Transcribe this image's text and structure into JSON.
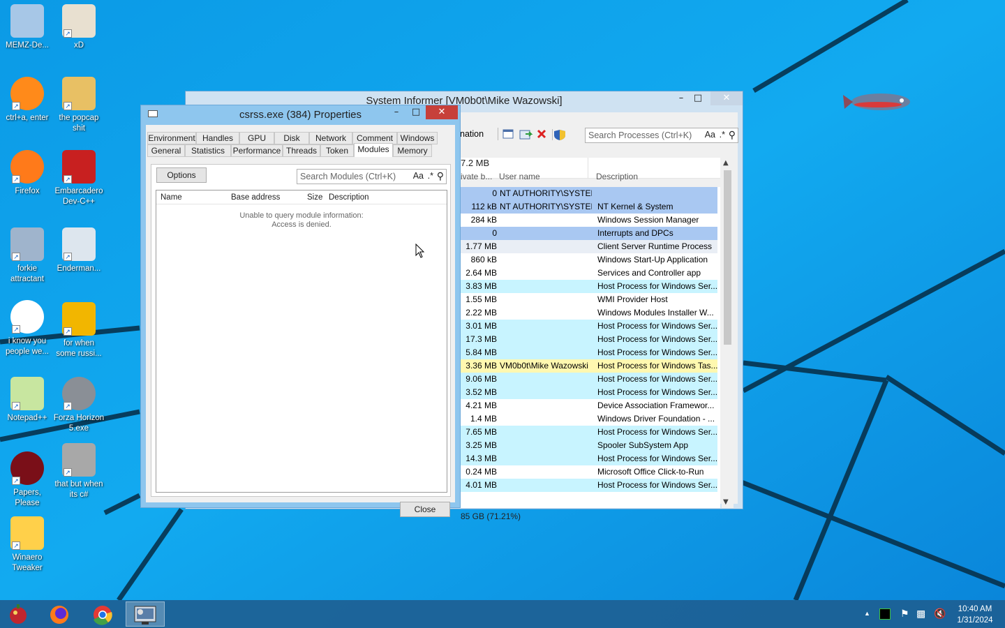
{
  "desktop_icons": [
    {
      "label": "MEMZ-De...",
      "icon": "recycle-bin-icon"
    },
    {
      "label": "xD",
      "icon": "xd-image-icon"
    },
    {
      "label": "ctrl+a, enter",
      "icon": "search-ring-icon"
    },
    {
      "label": "the popcap shit",
      "icon": "popcap-folder-icon"
    },
    {
      "label": "Firefox",
      "icon": "firefox-icon"
    },
    {
      "label": "Embarcadero Dev-C++",
      "icon": "devcpp-icon"
    },
    {
      "label": "forkie attractant",
      "icon": "system-informer-icon"
    },
    {
      "label": "Enderman...",
      "icon": "enderman-image-icon"
    },
    {
      "label": "i know you people we...",
      "icon": "chrome-icon"
    },
    {
      "label": "for when some russi...",
      "icon": "de-document-icon"
    },
    {
      "label": "Notepad++",
      "icon": "notepadpp-icon"
    },
    {
      "label": "Forza Horizon 5.exe",
      "icon": "flash-icon"
    },
    {
      "label": "Papers, Please",
      "icon": "papers-please-icon"
    },
    {
      "label": "that but when its c#",
      "icon": "copy-stack-icon"
    },
    {
      "label": "Winaero Tweaker",
      "icon": "winaero-icon"
    }
  ],
  "system_informer": {
    "title": "System Informer [VM0b0t\\Mike Wazowski]",
    "toolbar_partial_label": "nation",
    "search_placeholder": "Search Processes (Ctrl+K)",
    "search_case": "Aa",
    "search_regex": ".*",
    "header_total": "7.2 MB",
    "columns": {
      "private_bytes": "ivate b...",
      "user_name": "User name",
      "description": "Description"
    },
    "rows": [
      {
        "mem": "0",
        "user": "NT AUTHORITY\\SYSTEM",
        "desc": "",
        "hl": "#a9c8f2"
      },
      {
        "mem": "112 kB",
        "user": "NT AUTHORITY\\SYSTEM",
        "desc": "NT Kernel & System",
        "hl": "#a9c8f2"
      },
      {
        "mem": "284 kB",
        "user": "",
        "desc": "Windows Session Manager",
        "hl": ""
      },
      {
        "mem": "0",
        "user": "",
        "desc": "Interrupts and DPCs",
        "hl": "#a9c8f2"
      },
      {
        "mem": "1.77 MB",
        "user": "",
        "desc": "Client Server Runtime Process",
        "hl": "#e9eef5"
      },
      {
        "mem": "860 kB",
        "user": "",
        "desc": "Windows Start-Up Application",
        "hl": ""
      },
      {
        "mem": "2.64 MB",
        "user": "",
        "desc": "Services and Controller app",
        "hl": ""
      },
      {
        "mem": "3.83 MB",
        "user": "",
        "desc": "Host Process for Windows Ser...",
        "hl": "#c8f4ff"
      },
      {
        "mem": "1.55 MB",
        "user": "",
        "desc": "WMI Provider Host",
        "hl": ""
      },
      {
        "mem": "2.22 MB",
        "user": "",
        "desc": "Windows Modules Installer W...",
        "hl": ""
      },
      {
        "mem": "3.01 MB",
        "user": "",
        "desc": "Host Process for Windows Ser...",
        "hl": "#c8f4ff"
      },
      {
        "mem": "17.3 MB",
        "user": "",
        "desc": "Host Process for Windows Ser...",
        "hl": "#c8f4ff"
      },
      {
        "mem": "5.84 MB",
        "user": "",
        "desc": "Host Process for Windows Ser...",
        "hl": "#c8f4ff"
      },
      {
        "mem": "3.36 MB",
        "user": "VM0b0t\\Mike Wazowski",
        "desc": "Host Process for Windows Tas...",
        "hl": "#fff8b0"
      },
      {
        "mem": "9.06 MB",
        "user": "",
        "desc": "Host Process for Windows Ser...",
        "hl": "#c8f4ff"
      },
      {
        "mem": "3.52 MB",
        "user": "",
        "desc": "Host Process for Windows Ser...",
        "hl": "#c8f4ff"
      },
      {
        "mem": "4.21 MB",
        "user": "",
        "desc": "Device Association Framewor...",
        "hl": ""
      },
      {
        "mem": "1.4 MB",
        "user": "",
        "desc": "Windows Driver Foundation - ...",
        "hl": ""
      },
      {
        "mem": "7.65 MB",
        "user": "",
        "desc": "Host Process for Windows Ser...",
        "hl": "#c8f4ff"
      },
      {
        "mem": "3.25 MB",
        "user": "",
        "desc": "Spooler SubSystem App",
        "hl": "#c8f4ff"
      },
      {
        "mem": "14.3 MB",
        "user": "",
        "desc": "Host Process for Windows Ser...",
        "hl": "#c8f4ff"
      },
      {
        "mem": "0.24 MB",
        "user": "",
        "desc": "Microsoft Office Click-to-Run",
        "hl": ""
      },
      {
        "mem": "4.01 MB",
        "user": "",
        "desc": "Host Process for Windows Ser...",
        "hl": "#c8f4ff"
      }
    ],
    "status_text": "85 GB (71.21%)"
  },
  "properties": {
    "title": "csrss.exe (384) Properties",
    "tabs_row1": [
      "Environment",
      "Handles",
      "GPU",
      "Disk",
      "Network",
      "Comment",
      "Windows"
    ],
    "tabs_row2": [
      "General",
      "Statistics",
      "Performance",
      "Threads",
      "Token",
      "Modules",
      "Memory"
    ],
    "active_tab": "Modules",
    "options_label": "Options",
    "search_placeholder": "Search Modules (Ctrl+K)",
    "search_case": "Aa",
    "search_regex": ".*",
    "columns": [
      "Name",
      "Base address",
      "Size",
      "Description"
    ],
    "error_line1": "Unable to query module information:",
    "error_line2": "Access is denied.",
    "close_label": "Close"
  },
  "taskbar": {
    "apps": [
      "memz-icon",
      "firefox-icon",
      "chrome-icon",
      "system-informer-icon"
    ],
    "time": "10:40 AM",
    "date": "1/31/2024",
    "tray_up_arrow": "▲"
  },
  "colors": {
    "accent": "#1a8fe4",
    "close_red": "#c7403a",
    "highlight_service": "#c8f4ff",
    "highlight_system": "#a9c8f2",
    "highlight_user": "#fff8b0"
  }
}
